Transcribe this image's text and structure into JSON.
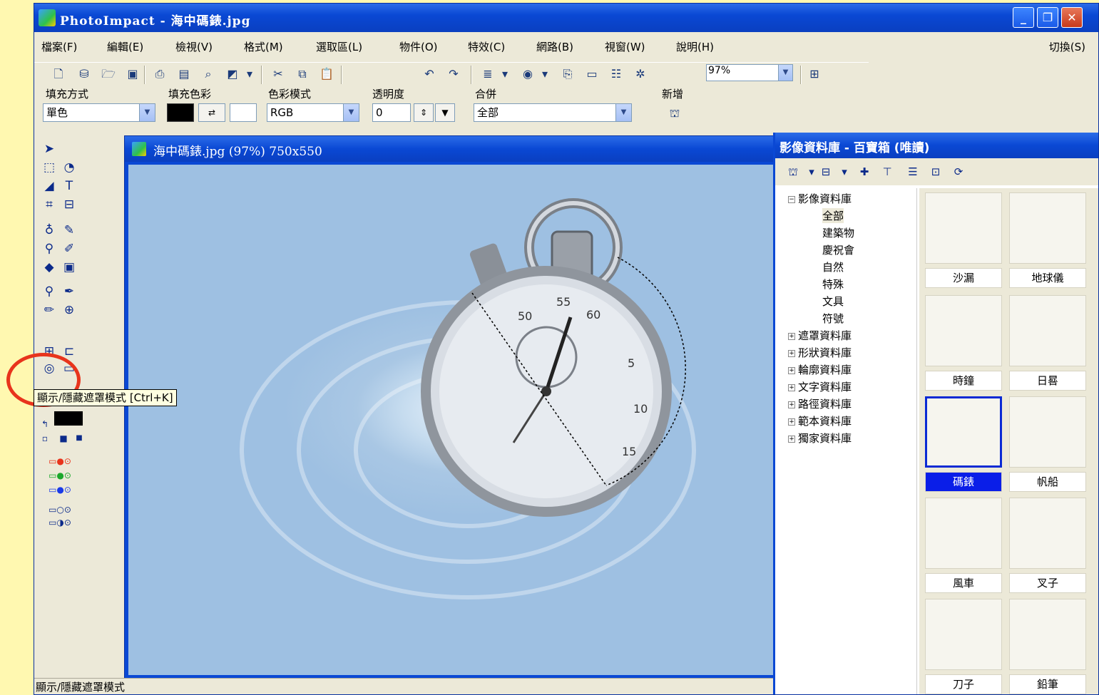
{
  "window": {
    "title": "PhotoImpact - 海中碼錶.jpg"
  },
  "menu": {
    "items": [
      "檔案(F)",
      "編輯(E)",
      "檢視(V)",
      "格式(M)",
      "選取區(L)",
      "物件(O)",
      "特效(C)",
      "網路(B)",
      "視窗(W)",
      "說明(H)"
    ],
    "switch": "切換(S)"
  },
  "toolbar": {
    "zoom_value": "97%"
  },
  "props": {
    "fill_mode_label": "填充方式",
    "fill_mode_value": "單色",
    "fill_color_label": "填充色彩",
    "color_mode_label": "色彩模式",
    "color_mode_value": "RGB",
    "opacity_label": "透明度",
    "opacity_value": "0",
    "merge_label": "合併",
    "merge_value": "全部",
    "new_label": "新增"
  },
  "tooltip": "顯示/隱藏遮罩模式 [Ctrl+K]",
  "document": {
    "title": "海中碼錶.jpg (97%) 750x550"
  },
  "library": {
    "title": "影像資料庫 - 百寶箱 (唯讀)",
    "tree": {
      "root": "影像資料庫",
      "children": [
        "全部",
        "建築物",
        "慶祝會",
        "自然",
        "特殊",
        "文具",
        "符號"
      ],
      "others": [
        "遮罩資料庫",
        "形狀資料庫",
        "輪廓資料庫",
        "文字資料庫",
        "路徑資料庫",
        "範本資料庫",
        "獨家資料庫"
      ]
    },
    "thumbs": [
      "沙漏",
      "地球儀",
      "時鐘",
      "日晷",
      "碼錶",
      "帆船",
      "風車",
      "叉子",
      "刀子",
      "鉛筆"
    ],
    "selected": "碼錶"
  },
  "status": "顯示/隱藏遮罩模式",
  "colors": {
    "accent": "#0a48d4",
    "highlight": "#e8341c",
    "background": "#fff8b0"
  }
}
